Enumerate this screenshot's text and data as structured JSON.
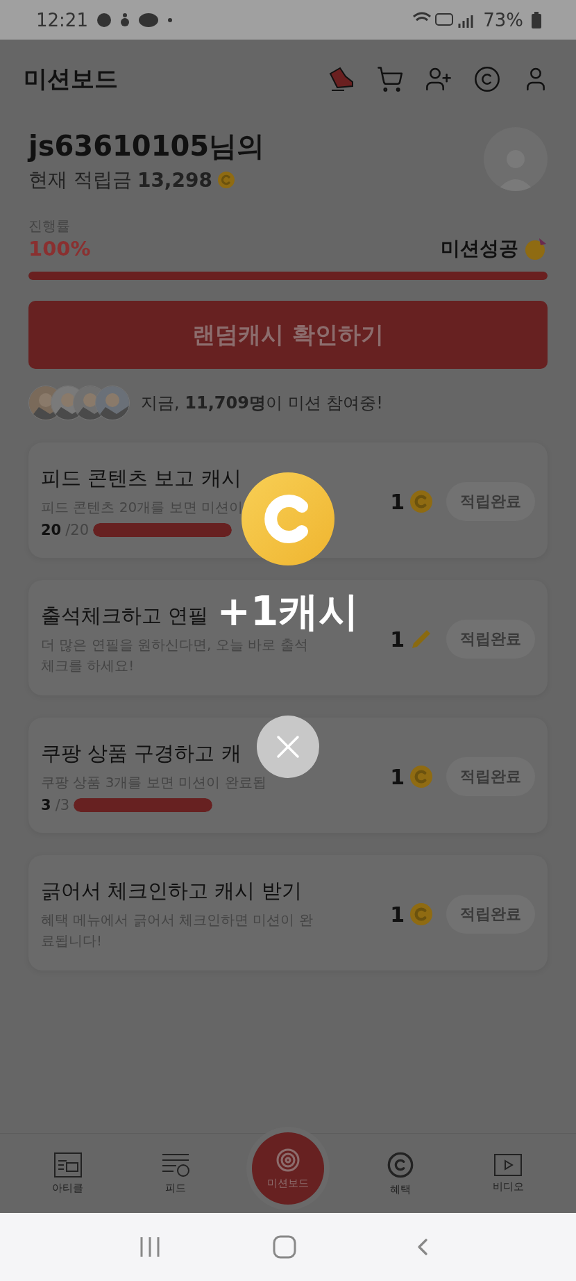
{
  "status_bar": {
    "time": "12:21",
    "battery": "73%"
  },
  "header": {
    "title": "미션보드"
  },
  "profile": {
    "name": "js63610105님의",
    "balance_label": "현재 적립금",
    "balance": "13,298"
  },
  "progress": {
    "label": "진행률",
    "percent": "100%",
    "status": "미션성공",
    "level": 1
  },
  "random_cash_button": "랜덤캐시 확인하기",
  "participants": {
    "text": "지금, **11,709명**이 미션 참여중!"
  },
  "missions": [
    {
      "kind": "progress",
      "title": "피드 콘텐츠 보고 캐시",
      "description": "피드 콘텐츠 20개를 보면 미션이",
      "done": "20",
      "total": "/20",
      "level": 1,
      "reward": {
        "amount": "1",
        "kind": "coin"
      },
      "button": "적립완료"
    },
    {
      "kind": "plain",
      "title": "출석체크하고 연필",
      "description": "더 많은 연필을 원하신다면, 오늘 바로 출석체크를 하세요!",
      "reward": {
        "amount": "1",
        "kind": "pencil"
      },
      "button": "적립완료"
    },
    {
      "kind": "progress",
      "title": "쿠팡 상품 구경하고 캐",
      "description": "쿠팡 상품 3개를 보면 미션이 완료됩",
      "done": "3",
      "total": "/3",
      "level": 1,
      "reward": {
        "amount": "1",
        "kind": "coin"
      },
      "button": "적립완료"
    },
    {
      "kind": "plain",
      "title": "긁어서 체크인하고 캐시 받기",
      "description": "혜택 메뉴에서 긁어서 체크인하면 미션이 완료됩니다!",
      "reward": {
        "amount": "1",
        "kind": "coin"
      },
      "button": "적립완료"
    }
  ],
  "reward_popup": {
    "text": "+1캐시"
  },
  "bottom_nav": [
    {
      "kind": "article",
      "label": "아티클",
      "selected": false
    },
    {
      "kind": "feed",
      "label": "피드",
      "selected": false
    },
    {
      "kind": "mission",
      "label": "미션보드",
      "selected": true
    },
    {
      "kind": "benefit",
      "label": "혜택",
      "selected": false
    },
    {
      "kind": "video",
      "label": "비디오",
      "selected": false
    }
  ]
}
